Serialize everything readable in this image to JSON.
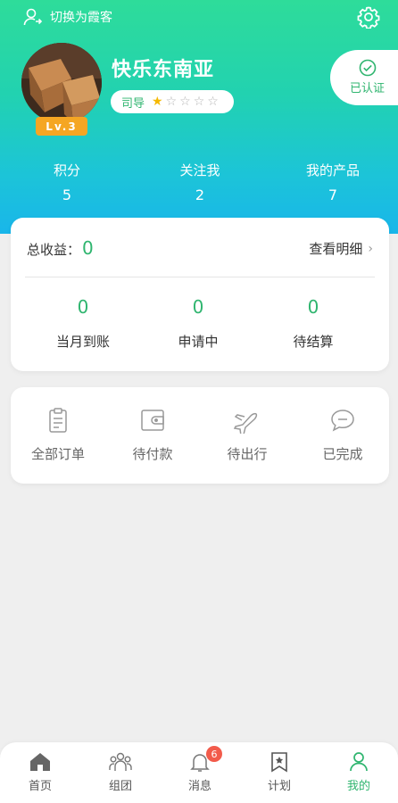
{
  "header": {
    "switch_label": "切换为霞客",
    "username": "快乐东南亚",
    "level": "Lv.3",
    "role": "司导",
    "rating": 1,
    "rating_max": 5,
    "verified_label": "已认证"
  },
  "stats": [
    {
      "label": "积分",
      "value": "5"
    },
    {
      "label": "关注我",
      "value": "2"
    },
    {
      "label": "我的产品",
      "value": "7"
    }
  ],
  "earnings": {
    "title": "总收益：",
    "total": "0",
    "detail_label": "查看明细",
    "items": [
      {
        "label": "当月到账",
        "value": "0"
      },
      {
        "label": "申请中",
        "value": "0"
      },
      {
        "label": "待结算",
        "value": "0"
      }
    ]
  },
  "orders": [
    {
      "label": "全部订单",
      "icon": "clipboard-icon"
    },
    {
      "label": "待付款",
      "icon": "wallet-icon"
    },
    {
      "label": "待出行",
      "icon": "plane-icon"
    },
    {
      "label": "已完成",
      "icon": "chat-bubble-icon"
    }
  ],
  "tabbar": {
    "items": [
      {
        "label": "首页",
        "icon": "home-icon"
      },
      {
        "label": "组团",
        "icon": "group-icon"
      },
      {
        "label": "消息",
        "icon": "bell-icon",
        "badge": "6"
      },
      {
        "label": "计划",
        "icon": "bookmark-star-icon"
      },
      {
        "label": "我的",
        "icon": "user-icon",
        "active": true
      }
    ]
  },
  "colors": {
    "accent_green": "#2fb56f",
    "header_gradient_top": "#2edc9a",
    "header_gradient_bottom": "#19b6ea",
    "level_orange": "#f5a623",
    "badge_red": "#f25b4b"
  }
}
